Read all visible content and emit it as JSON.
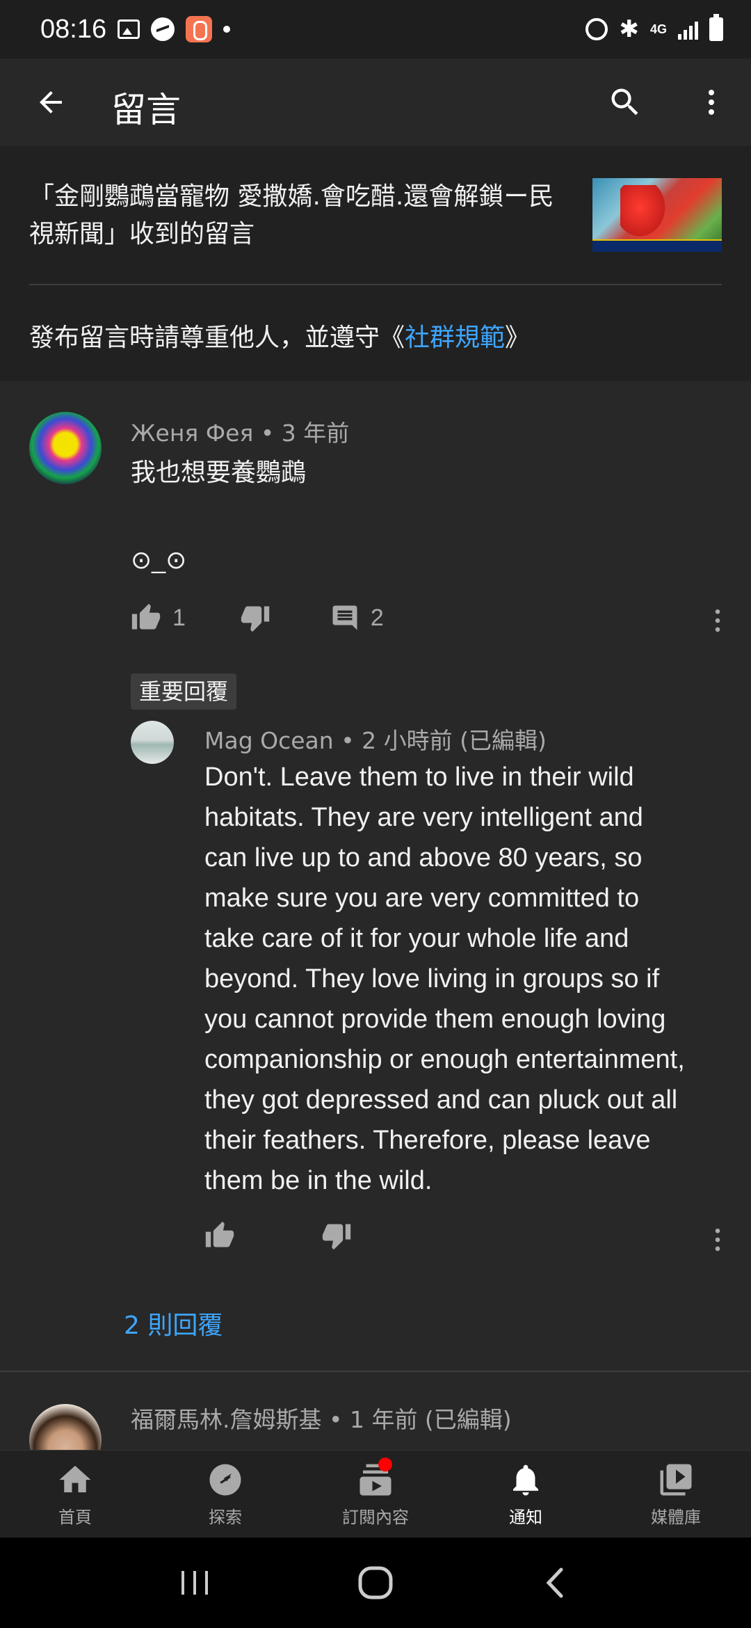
{
  "status_bar": {
    "time": "08:16",
    "network": "4G"
  },
  "app_bar": {
    "title": "留言"
  },
  "header": {
    "video_title": "「金剛鸚鵡當寵物 愛撒嬌.會吃醋.還會解鎖ー民視新聞」收到的留言",
    "guidelines_prefix": "發布留言時請尊重他人，並遵守《",
    "guidelines_link": "社群規範",
    "guidelines_suffix": "》"
  },
  "comments": [
    {
      "author": "Женя Фея",
      "time": "3 年前",
      "text_line1": "我也想要養鸚鵡",
      "text_line2": "⊙_⊙",
      "likes": "1",
      "replies": "2"
    }
  ],
  "pinned_reply": {
    "badge": "重要回覆",
    "author": "Mag Ocean",
    "time": "2 小時前 (已編輯)",
    "lines": [
      "Don't.  Leave them to live in their wild",
      "habitats.  They are very intelligent and",
      "can live up to and above 80 years, so",
      "make sure you are very committed to",
      "take care of it for your whole life and",
      "beyond.  They love living in groups so if",
      "you cannot provide them enough loving",
      "companionship or enough entertainment,",
      "they got depressed and can pluck out all",
      "their feathers.  Therefore, please leave",
      "them be in the wild."
    ]
  },
  "replies_link": "2 則回覆",
  "next_comment": {
    "author": "福爾馬林.詹姆斯基",
    "time": "1 年前 (已編輯)"
  },
  "bottom_nav": [
    {
      "label": "首頁",
      "icon": "home-icon"
    },
    {
      "label": "探索",
      "icon": "explore-icon"
    },
    {
      "label": "訂閱內容",
      "icon": "subscriptions-icon"
    },
    {
      "label": "通知",
      "icon": "bell-icon"
    },
    {
      "label": "媒體庫",
      "icon": "library-icon"
    }
  ],
  "colors": {
    "background": "#282828",
    "header_bg": "#212121",
    "link_blue": "#3ea6ff",
    "secondary_text": "#aaaaaa"
  }
}
